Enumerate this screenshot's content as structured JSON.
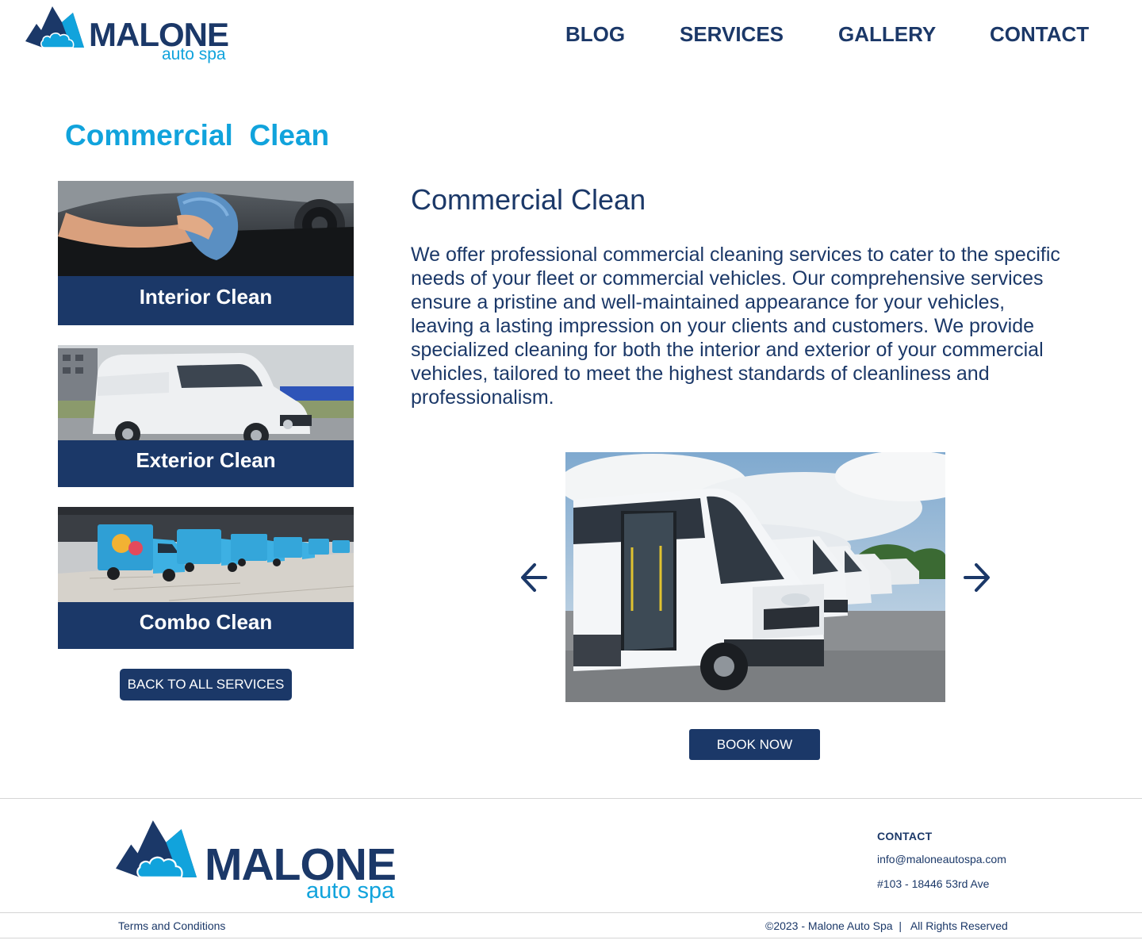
{
  "brand": {
    "name": "MALONE",
    "tagline": "auto spa",
    "navy": "#1b3868",
    "accent": "#11a3dc"
  },
  "nav": {
    "items": [
      "BLOG",
      "SERVICES",
      "GALLERY",
      "CONTACT"
    ]
  },
  "sidebar": {
    "title": "Commercial  Clean",
    "cards": [
      {
        "label": "Interior Clean",
        "image": "hand-wiping-dashboard-photo"
      },
      {
        "label": "Exterior Clean",
        "image": "white-van-photo"
      },
      {
        "label": "Combo Clean",
        "image": "blue-delivery-vans-photo"
      }
    ],
    "back_button": "BACK TO ALL SERVICES"
  },
  "main": {
    "title": "Commercial Clean",
    "description": "We offer professional commercial cleaning services to cater to the specific needs of your fleet or commercial vehicles. Our comprehensive services ensure a pristine and well-maintained appearance for your vehicles, leaving a lasting impression on your clients and customers. We provide specialized cleaning for both the interior and exterior of your commercial vehicles, tailored to meet the highest standards of cleanliness and professionalism.",
    "slider": {
      "image": "white-minibus-fleet-photo",
      "prev_icon": "arrow-left-icon",
      "next_icon": "arrow-right-icon"
    },
    "book_button": "BOOK NOW"
  },
  "footer": {
    "contact_heading": "CONTACT",
    "email": "info@maloneautospa.com",
    "address": "#103 - 18446 53rd Ave",
    "terms": "Terms and Conditions",
    "copyright": "©2023 - Malone Auto Spa  |   All Rights Reserved"
  }
}
